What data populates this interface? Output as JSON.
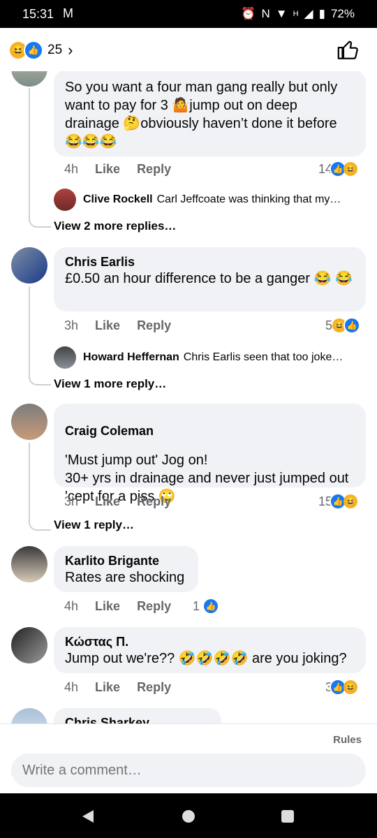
{
  "status": {
    "time": "15:31",
    "battery": "72%",
    "network": "H"
  },
  "header": {
    "reaction_count": "25"
  },
  "comments": [
    {
      "name": "",
      "text": "So you want a four man gang really but only want to pay for 3 🤷jump out on deep drainage 🤔obviously haven’t done it before 😂😂😂",
      "time": "4h",
      "like": "Like",
      "reply": "Reply",
      "reactions": "14",
      "reply_preview": {
        "name": "Clive Rockell",
        "text": "Carl Jeffcoate was thinking that my…"
      },
      "more": "View 2 more replies…"
    },
    {
      "name": "Chris Earlis",
      "text": "£0.50 an hour difference to be a ganger 😂 😂",
      "time": "3h",
      "like": "Like",
      "reply": "Reply",
      "reactions": "5",
      "reply_preview": {
        "name": "Howard Heffernan",
        "text": "Chris Earlis seen that too joke…"
      },
      "more": "View 1 more reply…"
    },
    {
      "name": "Craig Coleman",
      "text": "'Must jump out' Jog on!\n30+ yrs in drainage and never just jumped out 'cept for a piss 🙄",
      "time": "3h",
      "like": "Like",
      "reply": "Reply",
      "reactions": "15",
      "more": "View 1 reply…"
    },
    {
      "name": "Karlito Brigante",
      "text": "Rates are shocking",
      "time": "4h",
      "like": "Like",
      "reply": "Reply",
      "reactions": "1"
    },
    {
      "name": "Κώστας Π.",
      "text": "Jump out we're?? 🤣🤣🤣🤣 are you joking?",
      "time": "4h",
      "like": "Like",
      "reply": "Reply",
      "reactions": "3"
    },
    {
      "name": "Chris Sharkey"
    }
  ],
  "footer": {
    "rules": "Rules",
    "placeholder": "Write a comment…"
  },
  "colors": {
    "like_blue": "#1877f2",
    "haha_yellow": "#f7b125",
    "bubble": "#f0f2f5"
  },
  "icons": {
    "thumb": "thumbs-up-icon",
    "nav_back": "back-triangle-icon",
    "nav_home": "home-circle-icon",
    "nav_recent": "recents-square-icon"
  }
}
